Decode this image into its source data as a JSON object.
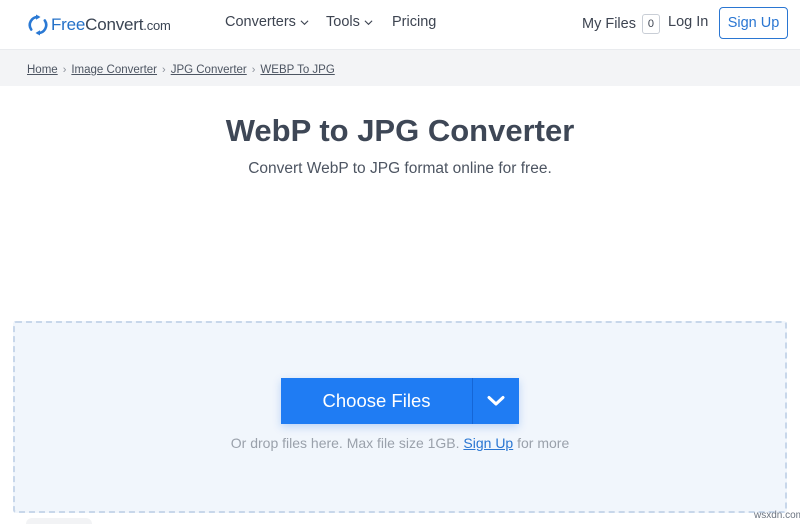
{
  "header": {
    "logo": {
      "free": "Free",
      "convert": "Convert",
      "com": ".com"
    },
    "nav": {
      "converters": "Converters",
      "tools": "Tools",
      "pricing": "Pricing"
    },
    "my_files": {
      "label": "My Files",
      "count": "0"
    },
    "login": "Log In",
    "signup": "Sign Up"
  },
  "breadcrumb": [
    "Home",
    "Image Converter",
    "JPG Converter",
    "WEBP To JPG"
  ],
  "main": {
    "title": "WebP to JPG Converter",
    "subtitle": "Convert WebP to JPG format online for free."
  },
  "dropzone": {
    "choose_files": "Choose Files",
    "hint_before": "Or drop files here. Max file size 1GB. ",
    "hint_link": "Sign Up",
    "hint_after": " for more"
  },
  "watermark": "wsxdn.com",
  "colors": {
    "accent": "#1f7cf3",
    "link": "#2a76d2",
    "dropzone_bg": "#f1f6fc"
  },
  "icons": {
    "logo": "refresh-icon",
    "nav_chevron": "chevron-down-icon",
    "dropdown": "chevron-down-icon"
  }
}
